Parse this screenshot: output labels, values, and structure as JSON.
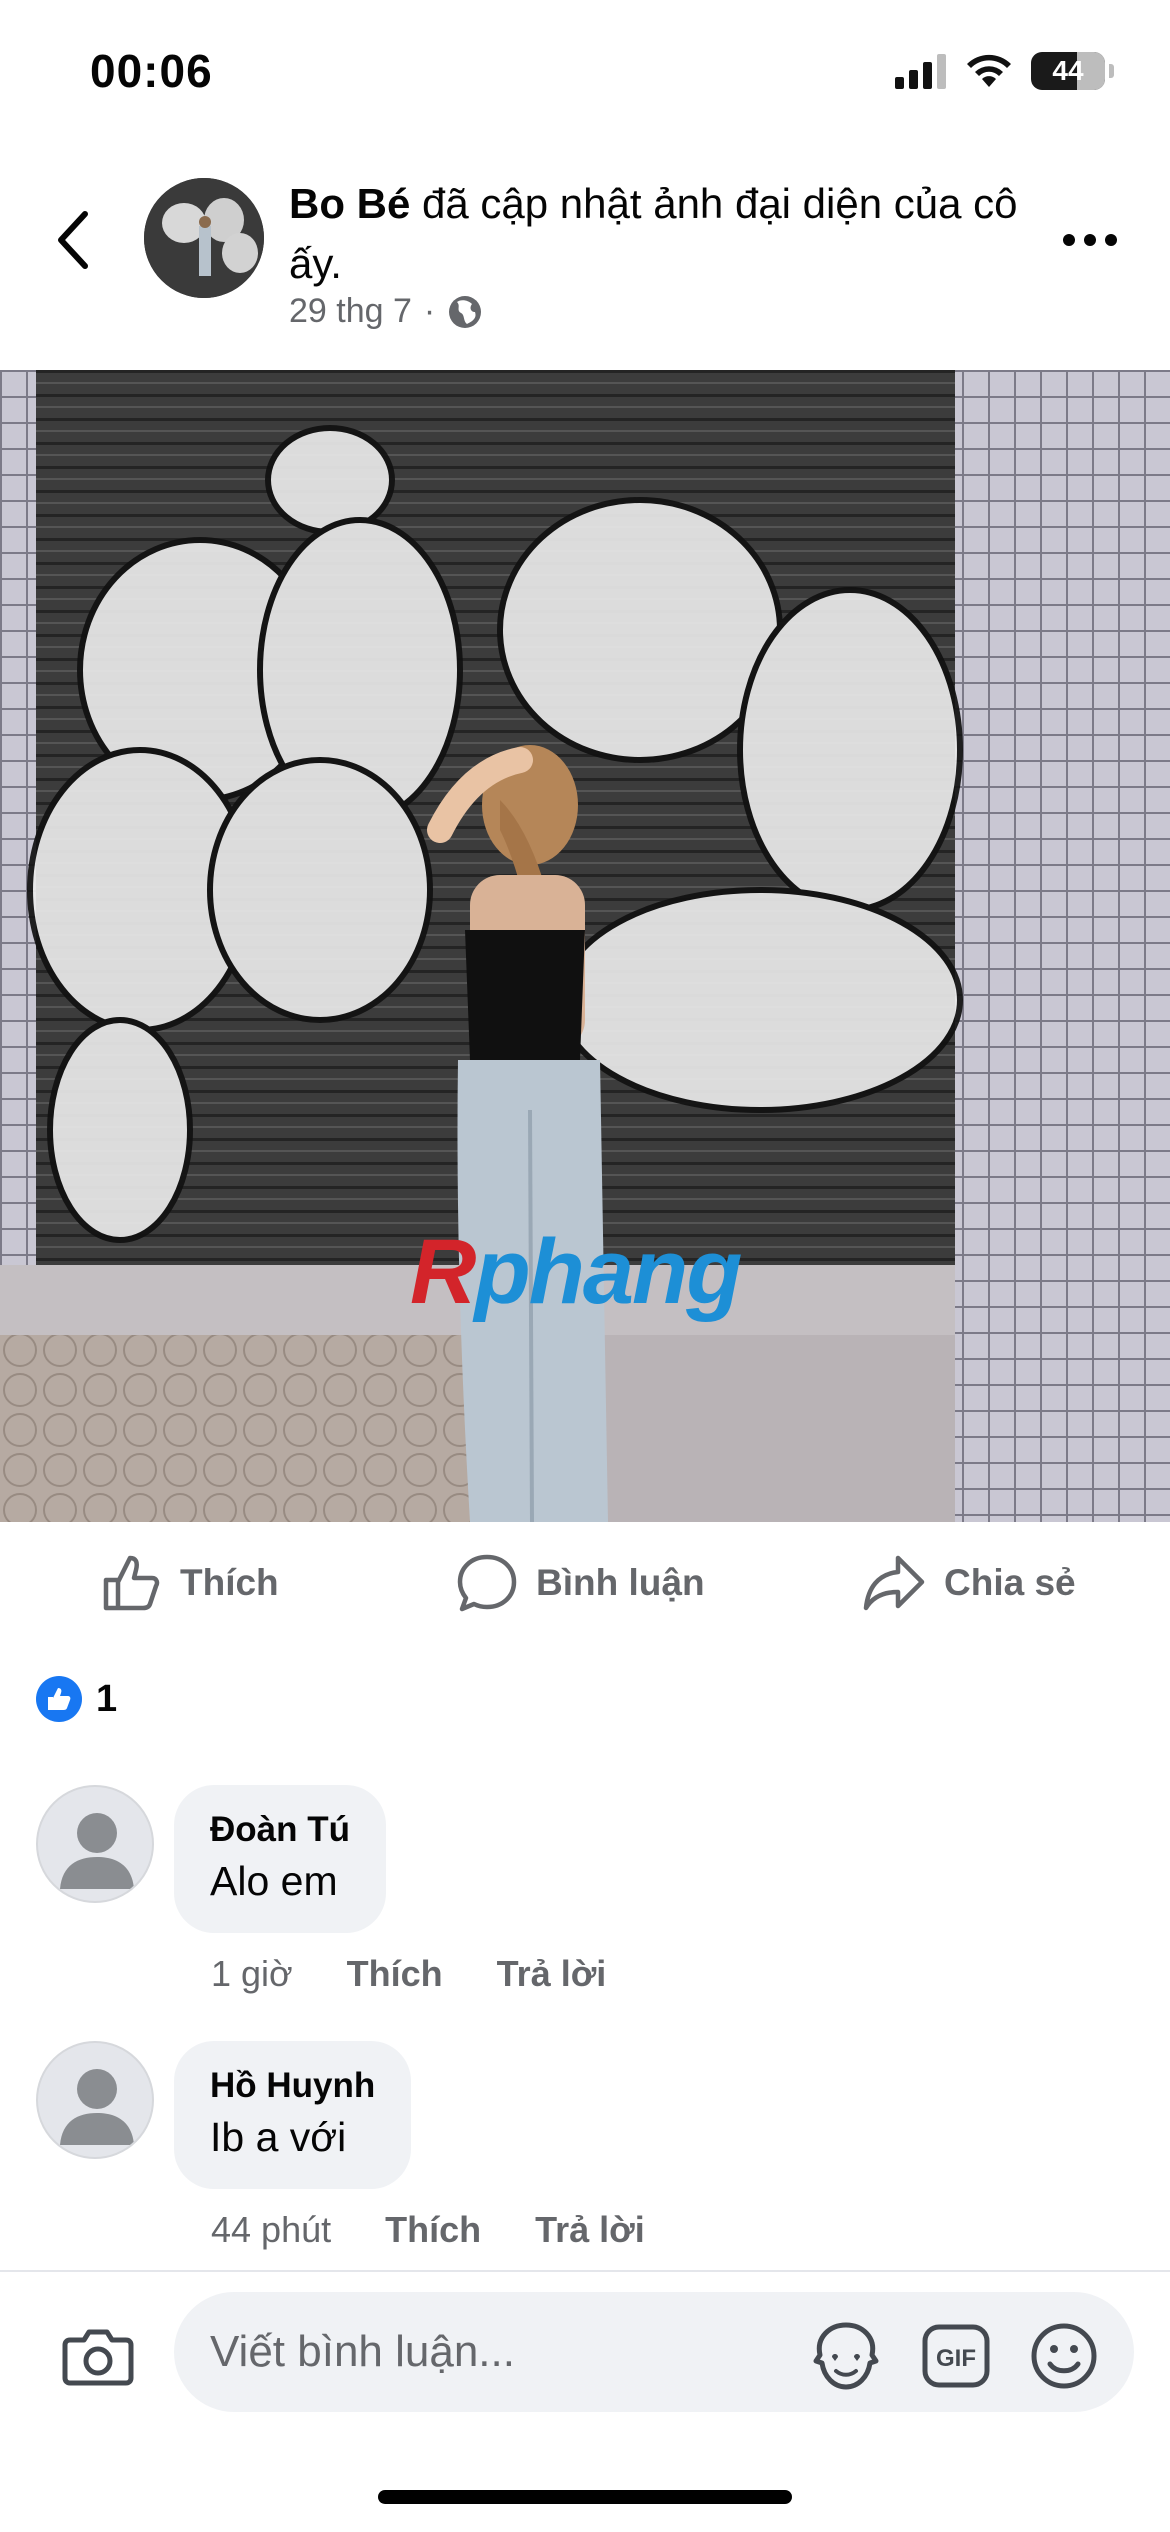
{
  "status_bar": {
    "time": "00:06",
    "battery": "44",
    "icons": [
      "signal-icon",
      "wifi-icon",
      "battery-icon"
    ]
  },
  "post": {
    "author": "Bo Bé",
    "action_text": "đã cập nhật ảnh đại diện của cô ấy.",
    "date": "29 thg 7",
    "separator": "·",
    "audience_icon": "globe-icon",
    "watermark_r": "R",
    "watermark_rest": "phang"
  },
  "actions": {
    "like": "Thích",
    "comment": "Bình luận",
    "share": "Chia sẻ"
  },
  "reactions": {
    "count": "1",
    "icon": "like-icon"
  },
  "comments": [
    {
      "name": "Đoàn Tú",
      "text": "Alo em",
      "time": "1 giờ",
      "like": "Thích",
      "reply": "Trả lời"
    },
    {
      "name": "Hồ Huynh",
      "text": "Ib a với",
      "time": "44 phút",
      "like": "Thích",
      "reply": "Trả lời"
    }
  ],
  "composer": {
    "placeholder": "Viết bình luận...",
    "icons": [
      "camera-icon",
      "avatar-sticker-icon",
      "gif-icon",
      "emoji-icon"
    ]
  },
  "colors": {
    "accent": "#1877f2",
    "secondary_text": "#65676b",
    "bubble_bg": "#f0f2f5"
  }
}
